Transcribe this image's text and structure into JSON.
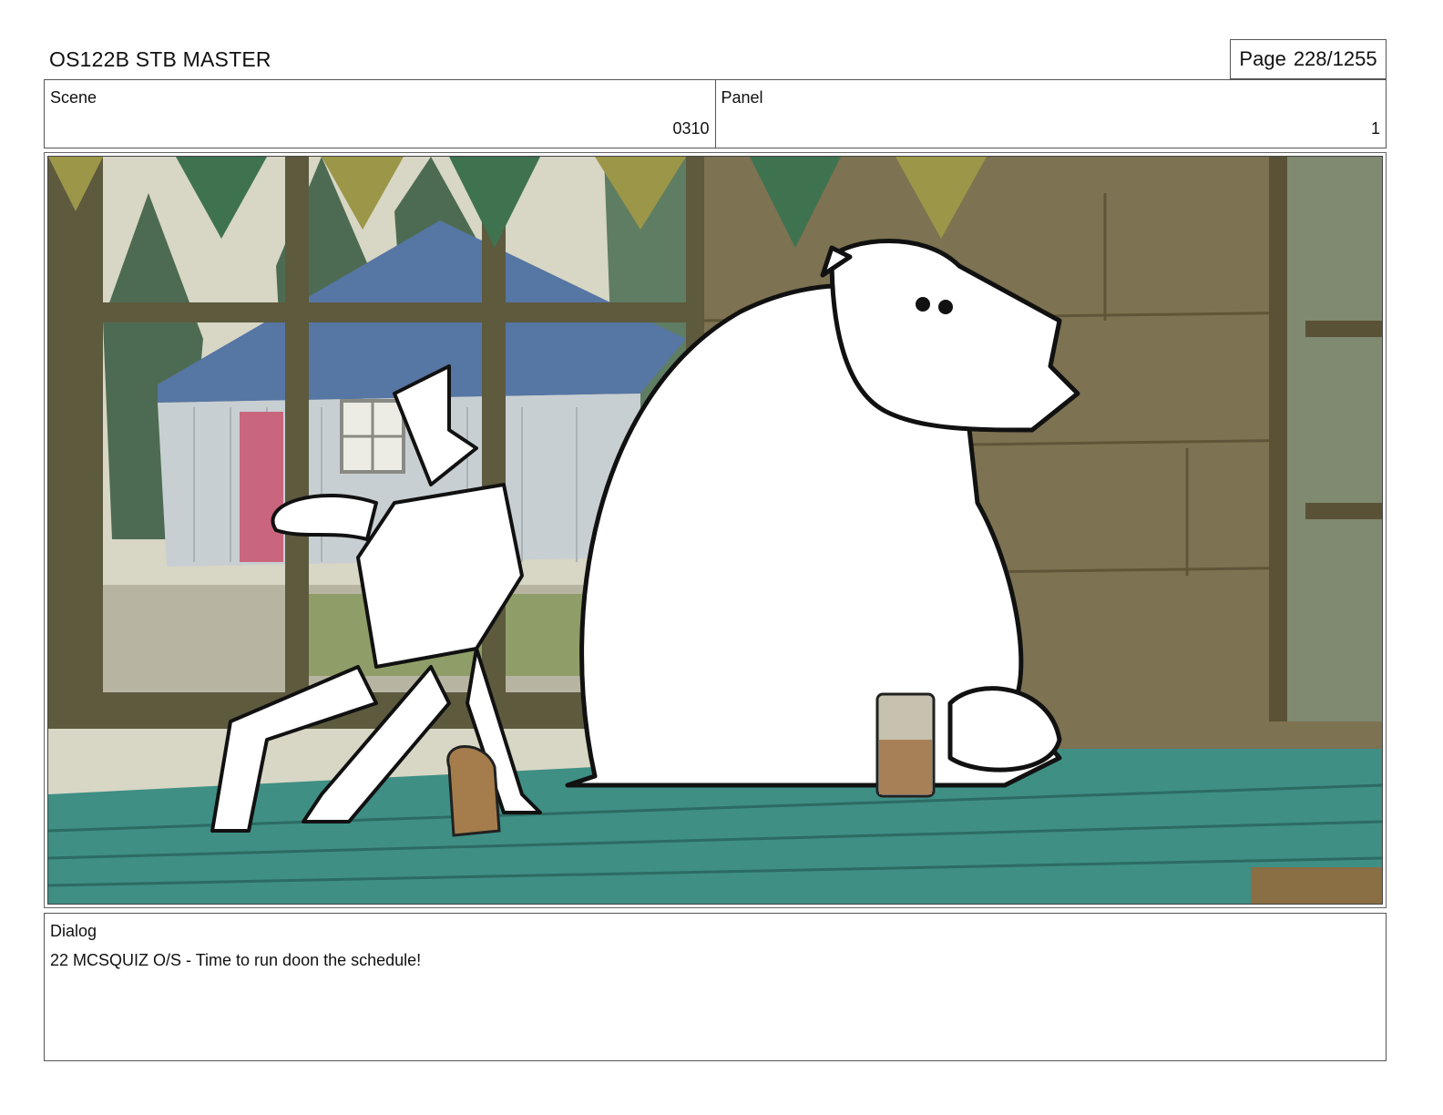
{
  "header": {
    "title": "OS122B STB MASTER",
    "page_label": "Page",
    "page_value": "228/1255"
  },
  "scene": {
    "label": "Scene",
    "value": "0310"
  },
  "panel": {
    "label": "Panel",
    "value": "1"
  },
  "dialog": {
    "label": "Dialog",
    "text": "22 MCSQUIZ O/S - Time to run doon the schedule!"
  },
  "colors": {
    "table": "#3f8f85",
    "wall": "#7d7251",
    "sky": "#d8d6c4",
    "roof": "#5676a3",
    "bunting_green": "#3f7350",
    "bunting_yellow": "#9c9648"
  }
}
